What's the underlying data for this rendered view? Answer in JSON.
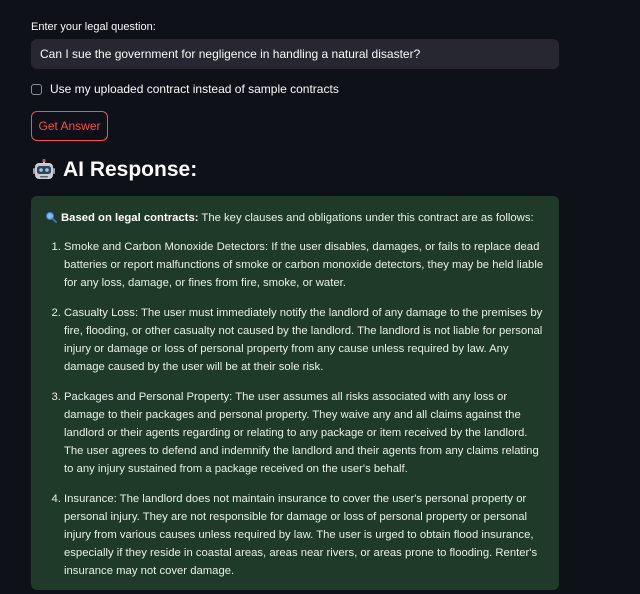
{
  "form": {
    "question_label": "Enter your legal question:",
    "question_value": "Can I sue the government for negligence in handling a natural disaster?",
    "checkbox_label": "Use my uploaded contract instead of sample contracts",
    "submit_label": "Get Answer"
  },
  "response": {
    "heading": "AI Response:",
    "intro_bold": "Based on legal contracts:",
    "intro_text": " The key clauses and obligations under this contract are as follows:",
    "items": [
      {
        "text": "Smoke and Carbon Monoxide Detectors: If the user disables, damages, or fails to replace dead batteries or report malfunctions of smoke or carbon monoxide detectors, they may be held liable for any loss, damage, or fines from fire, smoke, or water."
      },
      {
        "text": "Casualty Loss: The user must immediately notify the landlord of any damage to the premises by fire, flooding, or other casualty not caused by the landlord. The landlord is not liable for personal injury or damage or loss of personal property from any cause unless required by law. Any damage caused by the user will be at their sole risk."
      },
      {
        "text": "Packages and Personal Property: The user assumes all risks associated with any loss or damage to their packages and personal property. They waive any and all claims against the landlord or their agents regarding or relating to any package or item received by the landlord. The user agrees to defend and indemnify the landlord and their agents from any claims relating to any injury sustained from a package received on the user's behalf."
      },
      {
        "text": "Insurance: The landlord does not maintain insurance to cover the user's personal property or personal injury. They are not responsible for damage or loss of personal property or personal injury from various causes unless required by law. The user is urged to obtain flood insurance, especially if they reside in coastal areas, areas near rivers, or areas prone to flooding. Renter's insurance may not cover damage."
      }
    ]
  },
  "icons": {
    "title_icon": "pen-icon",
    "heading_icon": "robot-icon",
    "intro_icon": "magnifier-icon"
  },
  "colors": {
    "background": "#0e1117",
    "input_bg": "#262730",
    "accent": "#ff4b4b",
    "answer_bg": "#1f3a29"
  }
}
